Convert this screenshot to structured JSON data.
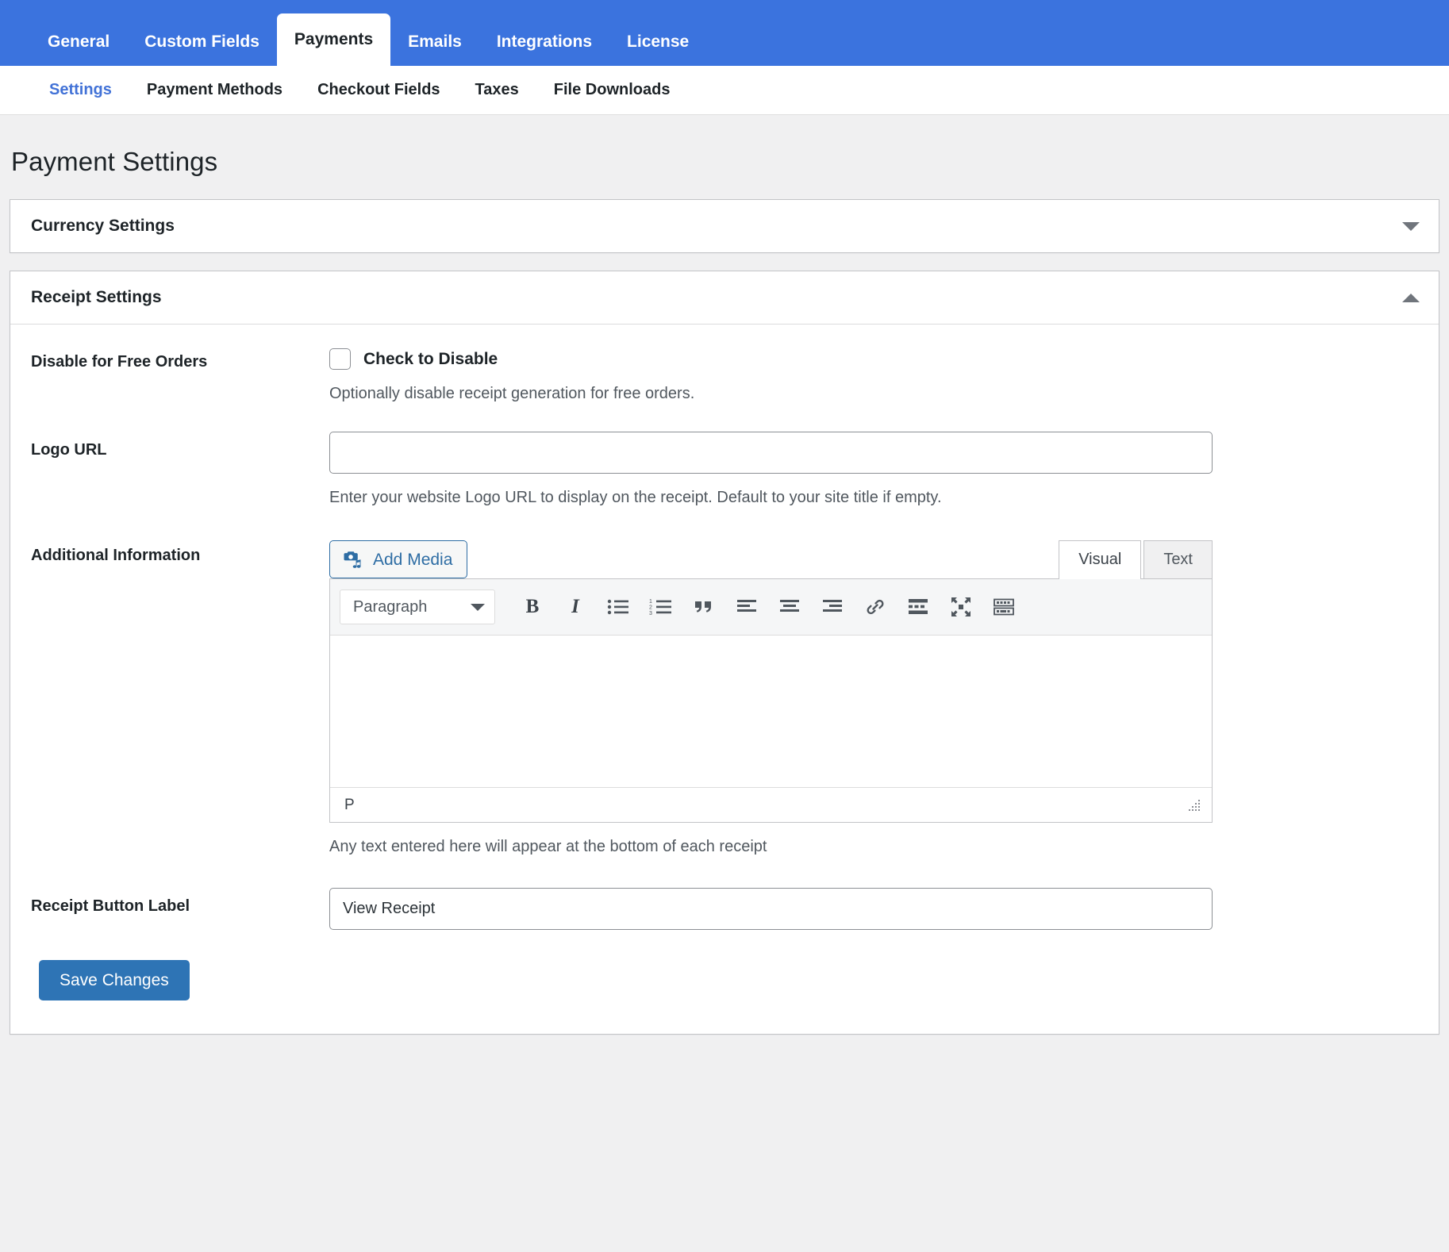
{
  "topnav": {
    "tabs": [
      {
        "label": "General",
        "active": false
      },
      {
        "label": "Custom Fields",
        "active": false
      },
      {
        "label": "Payments",
        "active": true
      },
      {
        "label": "Emails",
        "active": false
      },
      {
        "label": "Integrations",
        "active": false
      },
      {
        "label": "License",
        "active": false
      }
    ]
  },
  "subnav": {
    "items": [
      {
        "label": "Settings",
        "active": true
      },
      {
        "label": "Payment Methods",
        "active": false
      },
      {
        "label": "Checkout Fields",
        "active": false
      },
      {
        "label": "Taxes",
        "active": false
      },
      {
        "label": "File Downloads",
        "active": false
      }
    ]
  },
  "page": {
    "title": "Payment Settings"
  },
  "panels": {
    "currency": {
      "title": "Currency Settings",
      "toggle_icon": "chevron-down-icon",
      "expanded": false
    },
    "receipt": {
      "title": "Receipt Settings",
      "toggle_icon": "chevron-up-icon",
      "expanded": true
    }
  },
  "fields": {
    "disable_free_orders": {
      "label": "Disable for Free Orders",
      "checkbox_label": "Check to Disable",
      "checked": false,
      "help": "Optionally disable receipt generation for free orders."
    },
    "logo_url": {
      "label": "Logo URL",
      "value": "",
      "placeholder": "",
      "help": "Enter your website Logo URL to display on the receipt. Default to your site title if empty."
    },
    "additional_information": {
      "label": "Additional Information",
      "add_media_label": "Add Media",
      "add_media_icon": "add-media-icon",
      "editor_tabs": [
        {
          "label": "Visual",
          "active": true
        },
        {
          "label": "Text",
          "active": false
        }
      ],
      "format_select": "Paragraph",
      "toolbar_buttons": [
        {
          "name": "bold-icon",
          "glyph": "B"
        },
        {
          "name": "italic-icon",
          "glyph": "I"
        },
        {
          "name": "bulleted-list-icon",
          "glyph": ""
        },
        {
          "name": "numbered-list-icon",
          "glyph": ""
        },
        {
          "name": "blockquote-icon",
          "glyph": "“"
        },
        {
          "name": "align-left-icon",
          "glyph": ""
        },
        {
          "name": "align-center-icon",
          "glyph": ""
        },
        {
          "name": "align-right-icon",
          "glyph": ""
        },
        {
          "name": "link-icon",
          "glyph": ""
        },
        {
          "name": "read-more-icon",
          "glyph": ""
        },
        {
          "name": "fullscreen-icon",
          "glyph": ""
        },
        {
          "name": "keyboard-shortcuts-icon",
          "glyph": ""
        }
      ],
      "content": "",
      "status_path": "P",
      "resize_handle_icon": "resize-grip-icon",
      "help": "Any text entered here will appear at the bottom of each receipt"
    },
    "receipt_button_label": {
      "label": "Receipt Button Label",
      "value": "View Receipt",
      "placeholder": ""
    }
  },
  "actions": {
    "save_label": "Save Changes"
  },
  "colors": {
    "nav_blue": "#3b73de",
    "link_blue": "#4272d7",
    "save_blue": "#2e74b5",
    "media_blue": "#2e6da4",
    "page_bg": "#f0f0f1"
  }
}
